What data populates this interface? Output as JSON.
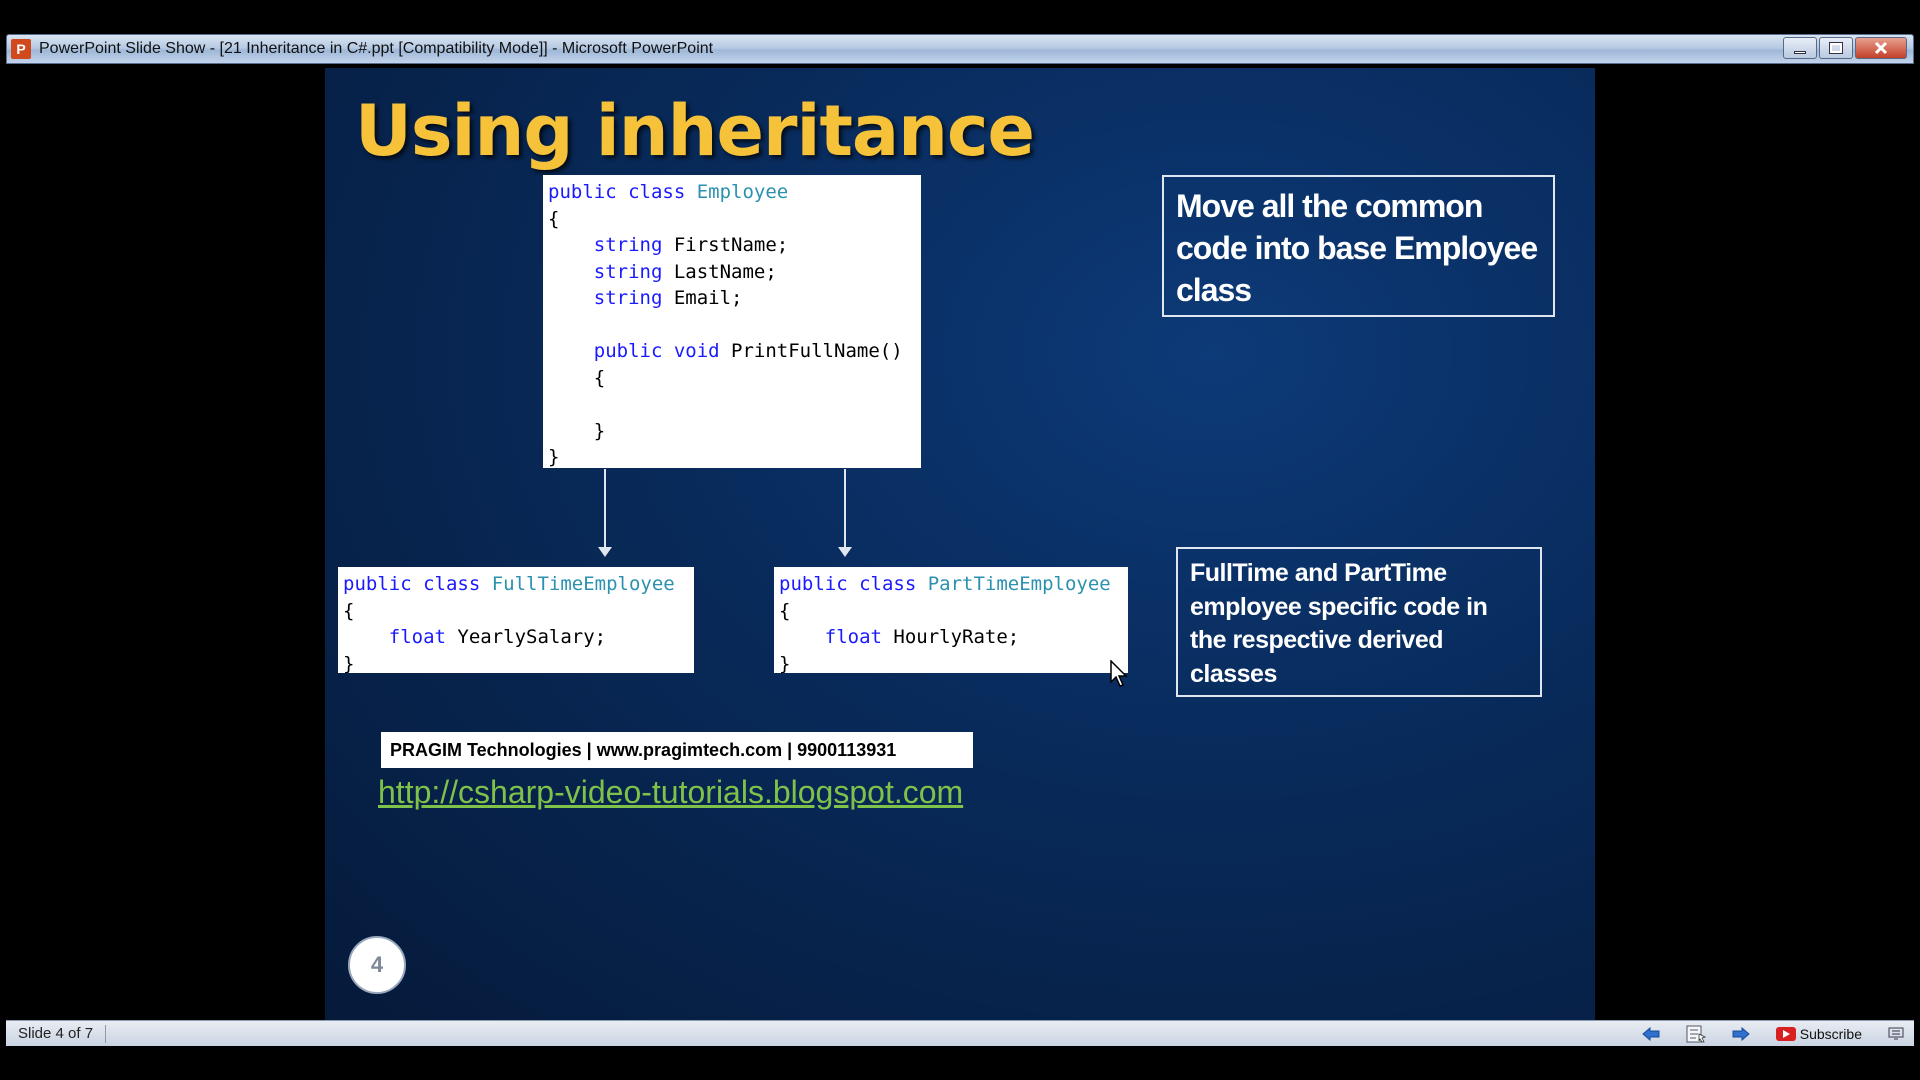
{
  "window": {
    "title": "PowerPoint Slide Show - [21 Inheritance in C#.ppt [Compatibility Mode]] - Microsoft PowerPoint",
    "app_icon_letter": "P"
  },
  "slide": {
    "title": "Using inheritance",
    "base_class": {
      "lines": [
        [
          {
            "t": "public class ",
            "c": "kw"
          },
          {
            "t": "Employee",
            "c": "ty"
          }
        ],
        [
          {
            "t": "{",
            "c": ""
          }
        ],
        [
          {
            "t": "    ",
            "c": ""
          },
          {
            "t": "string",
            "c": "kw"
          },
          {
            "t": " FirstName;",
            "c": ""
          }
        ],
        [
          {
            "t": "    ",
            "c": ""
          },
          {
            "t": "string",
            "c": "kw"
          },
          {
            "t": " LastName;",
            "c": ""
          }
        ],
        [
          {
            "t": "    ",
            "c": ""
          },
          {
            "t": "string",
            "c": "kw"
          },
          {
            "t": " Email;",
            "c": ""
          }
        ],
        [
          {
            "t": "",
            "c": ""
          }
        ],
        [
          {
            "t": "    ",
            "c": ""
          },
          {
            "t": "public void",
            "c": "kw"
          },
          {
            "t": " PrintFullName()",
            "c": ""
          }
        ],
        [
          {
            "t": "    {",
            "c": ""
          }
        ],
        [
          {
            "t": "",
            "c": ""
          }
        ],
        [
          {
            "t": "    }",
            "c": ""
          }
        ],
        [
          {
            "t": "}",
            "c": ""
          }
        ]
      ]
    },
    "fulltime_class": {
      "lines": [
        [
          {
            "t": "public class ",
            "c": "kw"
          },
          {
            "t": "FullTimeEmployee",
            "c": "ty"
          }
        ],
        [
          {
            "t": "{",
            "c": ""
          }
        ],
        [
          {
            "t": "    ",
            "c": ""
          },
          {
            "t": "float",
            "c": "kw"
          },
          {
            "t": " YearlySalary;",
            "c": ""
          }
        ],
        [
          {
            "t": "}",
            "c": ""
          }
        ]
      ]
    },
    "parttime_class": {
      "lines": [
        [
          {
            "t": "public class ",
            "c": "kw"
          },
          {
            "t": "PartTimeEmployee",
            "c": "ty"
          }
        ],
        [
          {
            "t": "{",
            "c": ""
          }
        ],
        [
          {
            "t": "    ",
            "c": ""
          },
          {
            "t": "float",
            "c": "kw"
          },
          {
            "t": " HourlyRate;",
            "c": ""
          }
        ],
        [
          {
            "t": "}",
            "c": ""
          }
        ]
      ]
    },
    "note_top": "Move all the common code into base Employee class",
    "note_bottom": "FullTime and PartTime employee specific code in the respective derived classes",
    "footer": "PRAGIM Technologies | www.pragimtech.com | 9900113931",
    "url": "http://csharp-video-tutorials.blogspot.com",
    "slide_number": "4"
  },
  "statusbar": {
    "slide_indicator": "Slide 4 of 7",
    "subscribe_label": "Subscribe"
  },
  "colors": {
    "title": "#f5c23a",
    "keyword": "#1a1aff",
    "type": "#2b91af",
    "url": "#7fc24a",
    "slide_bg": "#082a5a"
  },
  "icons": [
    "powerpoint-icon",
    "minimize-icon",
    "maximize-icon",
    "close-icon",
    "previous-arrow-icon",
    "menu-icon",
    "next-arrow-icon",
    "youtube-icon",
    "view-icon",
    "cursor-icon"
  ]
}
